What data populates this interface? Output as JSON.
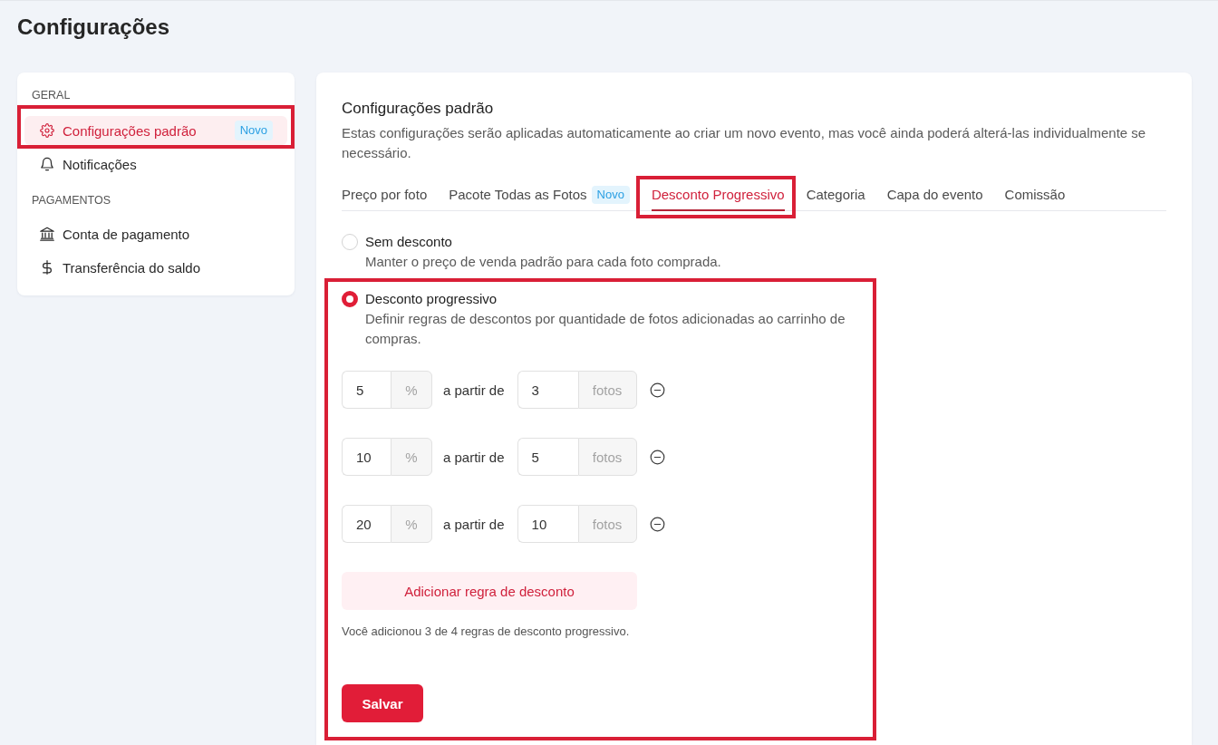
{
  "page": {
    "title": "Configurações"
  },
  "sidebar": {
    "sections": [
      {
        "heading": "GERAL",
        "items": [
          {
            "label": "Configurações padrão",
            "badge": "Novo",
            "selected": true,
            "highlighted": true
          },
          {
            "label": "Notificações",
            "selected": false,
            "highlighted": false
          }
        ]
      },
      {
        "heading": "PAGAMENTOS",
        "items": [
          {
            "label": "Conta de pagamento",
            "selected": false,
            "highlighted": false
          },
          {
            "label": "Transferência do saldo",
            "selected": false,
            "highlighted": false
          }
        ]
      }
    ]
  },
  "settings": {
    "title": "Configurações padrão",
    "description": "Estas configurações serão aplicadas automaticamente ao criar um novo evento, mas você ainda poderá alterá-las individualmente se necessário.",
    "tabs": [
      {
        "label": "Preço por foto",
        "selected": false,
        "highlighted": false
      },
      {
        "label": "Pacote Todas as Fotos",
        "badge": "Novo",
        "selected": false,
        "highlighted": false
      },
      {
        "label": "Desconto Progressivo",
        "selected": true,
        "highlighted": true
      },
      {
        "label": "Categoria",
        "selected": false,
        "highlighted": false
      },
      {
        "label": "Capa do evento",
        "selected": false,
        "highlighted": false
      },
      {
        "label": "Comissão",
        "selected": false,
        "highlighted": false
      }
    ],
    "discount_options": [
      {
        "kind": "none",
        "label": "Sem desconto",
        "description": "Manter o preço de venda padrão para cada foto comprada.",
        "selected": false,
        "highlighted": false
      },
      {
        "kind": "progressive",
        "label": "Desconto progressivo",
        "description": "Definir regras de descontos por quantidade de fotos adicionadas ao carrinho de compras.",
        "selected": true,
        "highlighted": true
      }
    ],
    "rules": [
      {
        "percent": "5",
        "percent_unit": "%",
        "connector": "a partir de",
        "quantity": "3",
        "quantity_unit": "fotos"
      },
      {
        "percent": "10",
        "percent_unit": "%",
        "connector": "a partir de",
        "quantity": "5",
        "quantity_unit": "fotos"
      },
      {
        "percent": "20",
        "percent_unit": "%",
        "connector": "a partir de",
        "quantity": "10",
        "quantity_unit": "fotos"
      }
    ],
    "add_rule_button": "Adicionar regra de desconto",
    "rules_note": "Você adicionou 3 de 4 regras de desconto progressivo.",
    "save_button": "Salvar"
  }
}
